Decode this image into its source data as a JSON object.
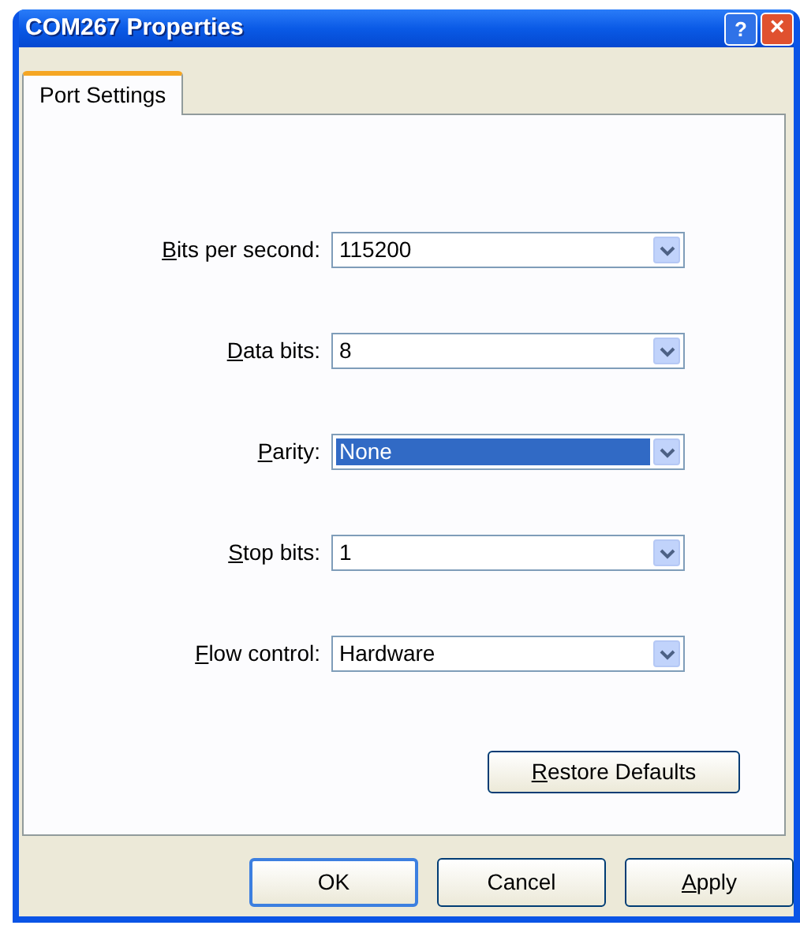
{
  "window": {
    "title": "COM267 Properties",
    "help_button": "?",
    "close_button": "×"
  },
  "tabs": [
    {
      "label": "Port Settings",
      "selected": true
    }
  ],
  "fields": [
    {
      "label": "Bits per second:",
      "mnemonic": true,
      "value": "115200",
      "focused": false
    },
    {
      "label": "Data bits:",
      "mnemonic": true,
      "value": "8",
      "focused": false
    },
    {
      "label": "Parity:",
      "mnemonic": true,
      "value": "None",
      "focused": true
    },
    {
      "label": "Stop bits:",
      "mnemonic": true,
      "value": "1",
      "focused": false
    },
    {
      "label": "Flow control:",
      "mnemonic": true,
      "value": "Hardware",
      "focused": false
    }
  ],
  "restore_button": {
    "label": "Restore Defaults",
    "mnemonic": true
  },
  "buttons": [
    {
      "label": "OK",
      "mnemonic": false,
      "default": true
    },
    {
      "label": "Cancel",
      "mnemonic": false,
      "default": false
    },
    {
      "label": "Apply",
      "mnemonic": true,
      "default": false
    }
  ]
}
